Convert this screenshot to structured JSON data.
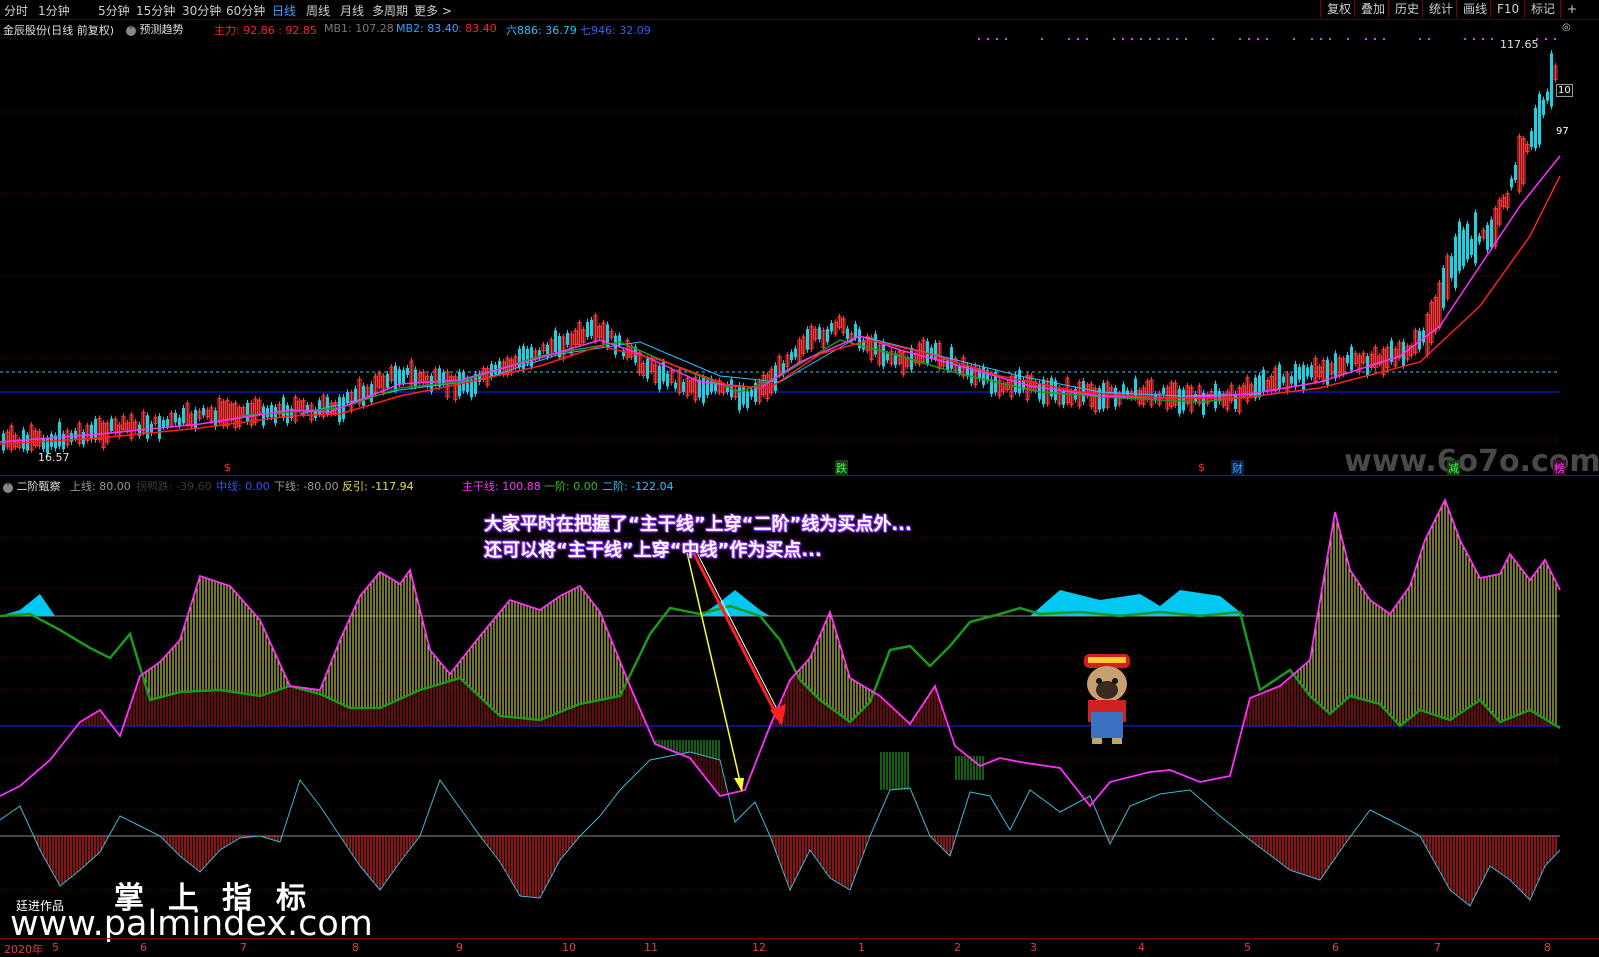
{
  "tabs": [
    "分时",
    "1分钟",
    "5分钟",
    "15分钟",
    "30分钟",
    "60分钟",
    "日线",
    "周线",
    "月线",
    "多周期",
    "更多 >"
  ],
  "active_tab": "日线",
  "right_buttons": [
    "复权",
    "叠加",
    "历史",
    "统计",
    "画线",
    "F10",
    "标记",
    "+"
  ],
  "stock_title": "金辰股份(日线 前复权)",
  "trend_toggle": "预测趋势",
  "main_indicators": [
    {
      "label": "主力: 92.86 : 92.85",
      "color": "#ff2020"
    },
    {
      "label": "MB1: 107.28",
      "color": "#7a7a7a"
    },
    {
      "label": "MB2: 83.40",
      "color": "#3aa0ff"
    },
    {
      "label": ": 83.40",
      "color": "#ff2020"
    },
    {
      "label": "六886: 36.79",
      "color": "#30c0ff"
    },
    {
      "label": "七946: 32.09",
      "color": "#3060ff"
    }
  ],
  "price_high": "117.65",
  "price_low": "16.57",
  "price_side_labels": [
    "10",
    "97"
  ],
  "event_marks": [
    {
      "text": "$",
      "color": "#ff3030"
    },
    {
      "text": "跌",
      "color": "#40ff40"
    },
    {
      "text": "$",
      "color": "#ff3030"
    },
    {
      "text": "财",
      "color": "#3aa0ff"
    },
    {
      "text": "减",
      "color": "#40ff40"
    },
    {
      "text": "榜",
      "color": "#ff40ff"
    }
  ],
  "sub_title": "二阶甄察",
  "sub_indicators": [
    {
      "label": "上线: 80.00",
      "color": "#9a9a9a"
    },
    {
      "label": "拐鸭跌: -39.60",
      "color": "#3a3a3a"
    },
    {
      "label": "中线: 0.00",
      "color": "#3050ff"
    },
    {
      "label": "下线: -80.00",
      "color": "#9a9a9a"
    },
    {
      "label": "反引: -117.94",
      "color": "#e0e040"
    },
    {
      "label": "主干线: 100.88",
      "color": "#ff30ff"
    },
    {
      "label": "一阶: 0.00",
      "color": "#30c030"
    },
    {
      "label": "二阶: -122.04",
      "color": "#30c0ff"
    }
  ],
  "annotation": [
    "大家平时在把握了“主干线”上穿“二阶”线为买点外...",
    "还可以将“主干线”上穿“中线”作为买点..."
  ],
  "watermark": "www.palmindex.com",
  "logo_text": "掌上指标",
  "author": "廷进作品",
  "site_watermark": "www.6o7o.com",
  "dates": [
    "2020年",
    "5",
    "6",
    "7",
    "8",
    "9",
    "10",
    "11",
    "12",
    "1",
    "2",
    "3",
    "4",
    "5",
    "6",
    "7",
    "8"
  ],
  "colors": {
    "red": "#ff2020",
    "magenta": "#ff30ff",
    "green": "#1a9a1a",
    "cyan": "#00c8f0",
    "yellow": "#e8e84a",
    "blue": "#1428ff"
  }
}
